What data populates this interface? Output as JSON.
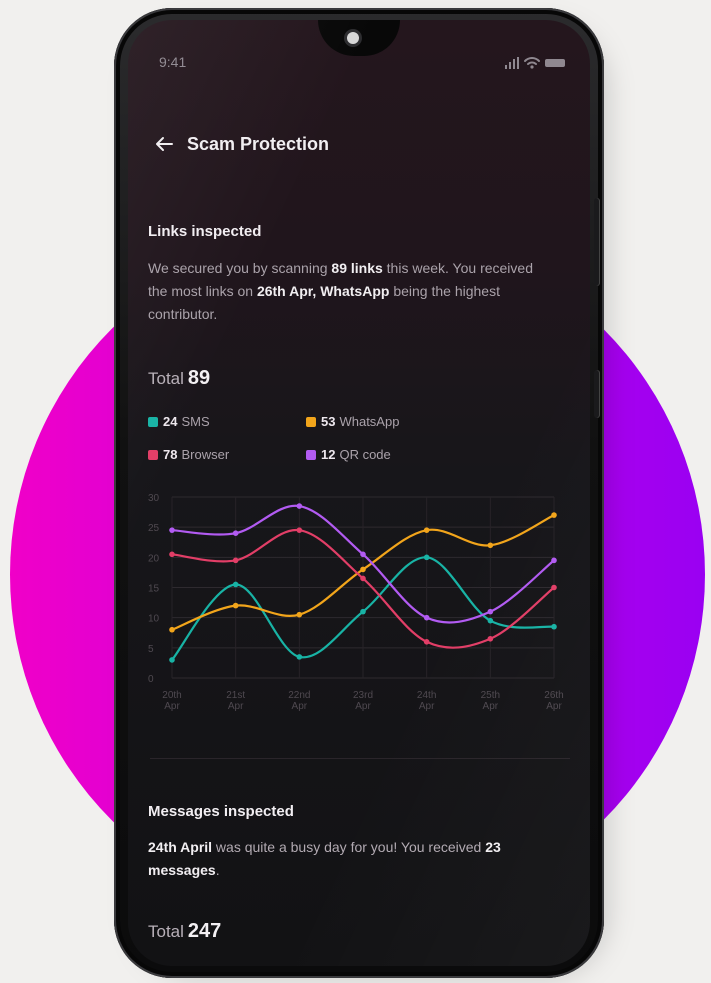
{
  "status": {
    "time": "9:41",
    "signal_icon": "signal-icon",
    "wifi_icon": "wifi-icon",
    "battery_icon": "battery-icon"
  },
  "header": {
    "back_icon": "back-arrow-icon",
    "title": "Scam Protection"
  },
  "links": {
    "heading": "Links inspected",
    "description_parts": {
      "p1": "We secured you by scanning ",
      "b1": "89 links",
      "p2": " this week. You received the most links on ",
      "b2": "26th Apr,",
      "p3": " ",
      "b3": "WhatsApp",
      "p4": " being the highest contributor."
    },
    "total_label": "Total",
    "total_value": "89",
    "legend": [
      {
        "count": "24",
        "label": "SMS",
        "color": "#18b3a5"
      },
      {
        "count": "53",
        "label": "WhatsApp",
        "color": "#f2a51b"
      },
      {
        "count": "78",
        "label": "Browser",
        "color": "#e23e67"
      },
      {
        "count": "12",
        "label": "QR code",
        "color": "#b25bf2"
      }
    ]
  },
  "chart_data": {
    "type": "line",
    "categories": [
      "20th Apr",
      "21st Apr",
      "22nd Apr",
      "23rd Apr",
      "24th Apr",
      "25th Apr",
      "26th Apr"
    ],
    "y_ticks": [
      0,
      5,
      10,
      15,
      20,
      25,
      30
    ],
    "ylim": [
      0,
      30
    ],
    "grid": true,
    "series": [
      {
        "name": "SMS",
        "color": "#18b3a5",
        "values": [
          3,
          15.5,
          3.5,
          11,
          20,
          9.5,
          8.5
        ]
      },
      {
        "name": "WhatsApp",
        "color": "#f2a51b",
        "values": [
          8,
          12,
          10.5,
          18,
          24.5,
          22,
          27
        ]
      },
      {
        "name": "Browser",
        "color": "#e23e67",
        "values": [
          20.5,
          19.5,
          24.5,
          16.5,
          6,
          6.5,
          15
        ]
      },
      {
        "name": "QR code",
        "color": "#b25bf2",
        "values": [
          24.5,
          24,
          28.5,
          20.5,
          10,
          11,
          19.5
        ]
      }
    ]
  },
  "messages": {
    "heading": "Messages inspected",
    "description_parts": {
      "b1": "24th April",
      "p1": " was quite a busy day for you! You received ",
      "b2": "23 messages",
      "p2": "."
    },
    "total_label": "Total",
    "total_value": "247"
  }
}
